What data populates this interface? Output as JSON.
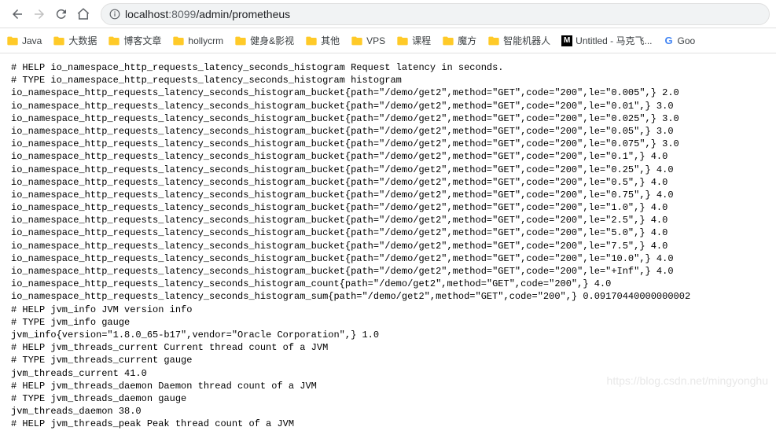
{
  "address": {
    "host": "localhost",
    "port": ":8099",
    "path": "/admin/prometheus"
  },
  "bookmarks": [
    {
      "type": "folder",
      "label": "Java"
    },
    {
      "type": "folder",
      "label": "大数据"
    },
    {
      "type": "folder",
      "label": "博客文章"
    },
    {
      "type": "folder",
      "label": "hollycrm"
    },
    {
      "type": "folder",
      "label": "健身&影视"
    },
    {
      "type": "folder",
      "label": "其他"
    },
    {
      "type": "folder",
      "label": "VPS"
    },
    {
      "type": "folder",
      "label": "课程"
    },
    {
      "type": "folder",
      "label": "魔方"
    },
    {
      "type": "folder",
      "label": "智能机器人"
    },
    {
      "type": "m",
      "label": "Untitled - 马克飞..."
    },
    {
      "type": "g",
      "label": "Goo"
    }
  ],
  "metrics": {
    "help1": "# HELP io_namespace_http_requests_latency_seconds_histogram Request latency in seconds.",
    "type1": "# TYPE io_namespace_http_requests_latency_seconds_histogram histogram",
    "buckets": [
      {
        "le": "0.005",
        "val": "2.0"
      },
      {
        "le": "0.01",
        "val": "3.0"
      },
      {
        "le": "0.025",
        "val": "3.0"
      },
      {
        "le": "0.05",
        "val": "3.0"
      },
      {
        "le": "0.075",
        "val": "3.0"
      },
      {
        "le": "0.1",
        "val": "4.0"
      },
      {
        "le": "0.25",
        "val": "4.0"
      },
      {
        "le": "0.5",
        "val": "4.0"
      },
      {
        "le": "0.75",
        "val": "4.0"
      },
      {
        "le": "1.0",
        "val": "4.0"
      },
      {
        "le": "2.5",
        "val": "4.0"
      },
      {
        "le": "5.0",
        "val": "4.0"
      },
      {
        "le": "7.5",
        "val": "4.0"
      },
      {
        "le": "10.0",
        "val": "4.0"
      },
      {
        "le": "+Inf",
        "val": "4.0"
      }
    ],
    "bucket_labels": {
      "path": "/demo/get2",
      "method": "GET",
      "code": "200"
    },
    "count_line": "io_namespace_http_requests_latency_seconds_histogram_count{path=\"/demo/get2\",method=\"GET\",code=\"200\",} 4.0",
    "sum_line": "io_namespace_http_requests_latency_seconds_histogram_sum{path=\"/demo/get2\",method=\"GET\",code=\"200\",} 0.09170440000000002",
    "jvm_info_help": "# HELP jvm_info JVM version info",
    "jvm_info_type": "# TYPE jvm_info gauge",
    "jvm_info_line": "jvm_info{version=\"1.8.0_65-b17\",vendor=\"Oracle Corporation\",} 1.0",
    "threads_cur_help": "# HELP jvm_threads_current Current thread count of a JVM",
    "threads_cur_type": "# TYPE jvm_threads_current gauge",
    "threads_cur_line": "jvm_threads_current 41.0",
    "threads_daemon_help": "# HELP jvm_threads_daemon Daemon thread count of a JVM",
    "threads_daemon_type": "# TYPE jvm_threads_daemon gauge",
    "threads_daemon_line": "jvm_threads_daemon 38.0",
    "threads_peak_help": "# HELP jvm_threads_peak Peak thread count of a JVM"
  },
  "watermark": "https://blog.csdn.net/mingyonghu"
}
